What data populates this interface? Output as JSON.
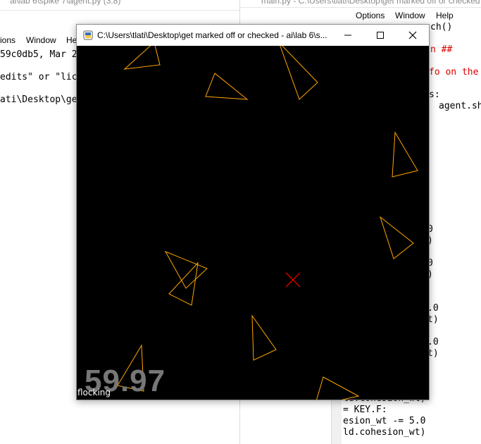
{
  "background_left": {
    "title": "ai\\lab 6\\spike 7\\agent.py (3.8)",
    "menu": [
      "ions",
      "Window",
      "He"
    ],
    "lines": [
      "59c0db5, Mar 2",
      "edits\" or \"lic",
      "ati\\Desktop\\ge"
    ]
  },
  "background_right": {
    "title": "main.py - C:\\Users\\tlati\\Desktop\\get marked off or checked",
    "menu": [
      "Options",
      "Window",
      "Help"
    ],
    "code_lines": [
      {
        "text": "ch()",
        "color": "black"
      },
      {
        "text": "n ##",
        "color": "red"
      },
      {
        "text": "fo on the",
        "color": "red"
      },
      {
        "text": "s:",
        "color": "black"
      },
      {
        "text": "agent.sh",
        "color": "black"
      },
      {
        "text": "0",
        "color": "black"
      },
      {
        "text": ")",
        "color": "black"
      },
      {
        "text": "0",
        "color": "black"
      },
      {
        "text": ")",
        "color": "black"
      },
      {
        "text": ".0",
        "color": "black"
      },
      {
        "text": "t)",
        "color": "black"
      },
      {
        "text": ".0",
        "color": "black"
      },
      {
        "text": "t)",
        "color": "black"
      },
      {
        "text": "ld.cohesion_wt)",
        "color": "black"
      },
      {
        "text": "= KEY.F:",
        "color": "black"
      },
      {
        "text": "esion_wt -= 5.0",
        "color": "black"
      },
      {
        "text": "ld.cohesion_wt)",
        "color": "black"
      }
    ]
  },
  "window": {
    "title": "C:\\Users\\tlati\\Desktop\\get marked off or checked - ai\\lab 6\\s...",
    "minimize_icon": "minimize-icon",
    "maximize_icon": "maximize-icon",
    "close_icon": "close-icon"
  },
  "simulation": {
    "fps": "59.97",
    "mode": "flocking",
    "agent_color": "#ffa500",
    "target_color": "#ff0000",
    "background_color": "#000000"
  }
}
